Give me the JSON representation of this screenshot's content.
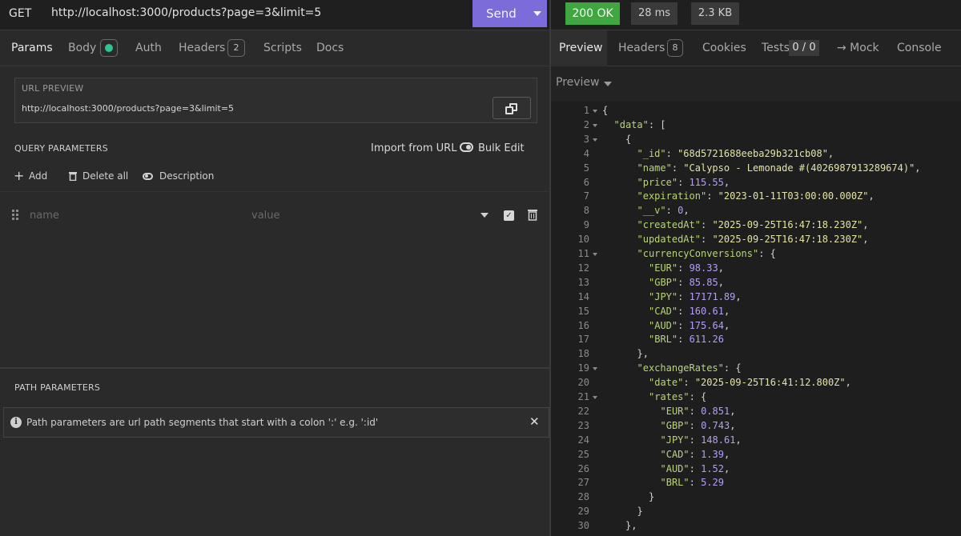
{
  "request": {
    "method": "GET",
    "url": "http://localhost:3000/products?page=3&limit=5",
    "send_label": "Send"
  },
  "left_tabs": {
    "params": "Params",
    "body": "Body",
    "auth": "Auth",
    "headers": "Headers",
    "headers_count": "2",
    "scripts": "Scripts",
    "docs": "Docs"
  },
  "url_preview": {
    "title": "URL PREVIEW",
    "url": "http://localhost:3000/products?page=3&limit=5"
  },
  "query_params": {
    "title": "QUERY PARAMETERS",
    "import_label": "Import from URL",
    "bulk_edit_label": "Bulk Edit",
    "add_label": "Add",
    "delete_all_label": "Delete all",
    "description_label": "Description",
    "name_placeholder": "name",
    "value_placeholder": "value"
  },
  "path_params": {
    "title": "PATH PARAMETERS",
    "info": "Path parameters are url path segments that start with a colon ':' e.g. ':id'"
  },
  "response_meta": {
    "status": "200 OK",
    "time": "28 ms",
    "size": "2.3 KB"
  },
  "right_tabs": {
    "preview": "Preview",
    "headers": "Headers",
    "headers_count": "8",
    "cookies": "Cookies",
    "tests": "Tests",
    "tests_count": "0 / 0",
    "mock": "→ Mock",
    "console": "Console"
  },
  "preview_mode": "Preview",
  "colors": {
    "accent": "#7b6cd9",
    "status_ok": "#3fa640",
    "json_key": "#b9d47a",
    "json_string": "#e3e4a6",
    "json_number": "#b69ef8"
  },
  "code_lines": [
    {
      "n": "1",
      "fold": true,
      "indent": 0,
      "parts": [
        [
          "p",
          "{"
        ]
      ]
    },
    {
      "n": "2",
      "fold": true,
      "indent": 1,
      "parts": [
        [
          "k",
          "\"data\""
        ],
        [
          "p",
          ": ["
        ]
      ]
    },
    {
      "n": "3",
      "fold": true,
      "indent": 2,
      "parts": [
        [
          "p",
          "{"
        ]
      ]
    },
    {
      "n": "4",
      "fold": false,
      "indent": 3,
      "parts": [
        [
          "k",
          "\"_id\""
        ],
        [
          "p",
          ": "
        ],
        [
          "s",
          "\"68d5721688eeba29b321cb08\""
        ],
        [
          "p",
          ","
        ]
      ]
    },
    {
      "n": "5",
      "fold": false,
      "indent": 3,
      "parts": [
        [
          "k",
          "\"name\""
        ],
        [
          "p",
          ": "
        ],
        [
          "s",
          "\"Calypso - Lemonade #(4026987913289674)\""
        ],
        [
          "p",
          ","
        ]
      ]
    },
    {
      "n": "6",
      "fold": false,
      "indent": 3,
      "parts": [
        [
          "k",
          "\"price\""
        ],
        [
          "p",
          ": "
        ],
        [
          "n",
          "115.55"
        ],
        [
          "p",
          ","
        ]
      ]
    },
    {
      "n": "7",
      "fold": false,
      "indent": 3,
      "parts": [
        [
          "k",
          "\"expiration\""
        ],
        [
          "p",
          ": "
        ],
        [
          "s",
          "\"2023-01-11T03:00:00.000Z\""
        ],
        [
          "p",
          ","
        ]
      ]
    },
    {
      "n": "8",
      "fold": false,
      "indent": 3,
      "parts": [
        [
          "k",
          "\"__v\""
        ],
        [
          "p",
          ": "
        ],
        [
          "n",
          "0"
        ],
        [
          "p",
          ","
        ]
      ]
    },
    {
      "n": "9",
      "fold": false,
      "indent": 3,
      "parts": [
        [
          "k",
          "\"createdAt\""
        ],
        [
          "p",
          ": "
        ],
        [
          "s",
          "\"2025-09-25T16:47:18.230Z\""
        ],
        [
          "p",
          ","
        ]
      ]
    },
    {
      "n": "10",
      "fold": false,
      "indent": 3,
      "parts": [
        [
          "k",
          "\"updatedAt\""
        ],
        [
          "p",
          ": "
        ],
        [
          "s",
          "\"2025-09-25T16:47:18.230Z\""
        ],
        [
          "p",
          ","
        ]
      ]
    },
    {
      "n": "11",
      "fold": true,
      "indent": 3,
      "parts": [
        [
          "k",
          "\"currencyConversions\""
        ],
        [
          "p",
          ": {"
        ]
      ]
    },
    {
      "n": "12",
      "fold": false,
      "indent": 4,
      "parts": [
        [
          "k",
          "\"EUR\""
        ],
        [
          "p",
          ": "
        ],
        [
          "n",
          "98.33"
        ],
        [
          "p",
          ","
        ]
      ]
    },
    {
      "n": "13",
      "fold": false,
      "indent": 4,
      "parts": [
        [
          "k",
          "\"GBP\""
        ],
        [
          "p",
          ": "
        ],
        [
          "n",
          "85.85"
        ],
        [
          "p",
          ","
        ]
      ]
    },
    {
      "n": "14",
      "fold": false,
      "indent": 4,
      "parts": [
        [
          "k",
          "\"JPY\""
        ],
        [
          "p",
          ": "
        ],
        [
          "n",
          "17171.89"
        ],
        [
          "p",
          ","
        ]
      ]
    },
    {
      "n": "15",
      "fold": false,
      "indent": 4,
      "parts": [
        [
          "k",
          "\"CAD\""
        ],
        [
          "p",
          ": "
        ],
        [
          "n",
          "160.61"
        ],
        [
          "p",
          ","
        ]
      ]
    },
    {
      "n": "16",
      "fold": false,
      "indent": 4,
      "parts": [
        [
          "k",
          "\"AUD\""
        ],
        [
          "p",
          ": "
        ],
        [
          "n",
          "175.64"
        ],
        [
          "p",
          ","
        ]
      ]
    },
    {
      "n": "17",
      "fold": false,
      "indent": 4,
      "parts": [
        [
          "k",
          "\"BRL\""
        ],
        [
          "p",
          ": "
        ],
        [
          "n",
          "611.26"
        ]
      ]
    },
    {
      "n": "18",
      "fold": false,
      "indent": 3,
      "parts": [
        [
          "p",
          "},"
        ]
      ]
    },
    {
      "n": "19",
      "fold": true,
      "indent": 3,
      "parts": [
        [
          "k",
          "\"exchangeRates\""
        ],
        [
          "p",
          ": {"
        ]
      ]
    },
    {
      "n": "20",
      "fold": false,
      "indent": 4,
      "parts": [
        [
          "k",
          "\"date\""
        ],
        [
          "p",
          ": "
        ],
        [
          "s",
          "\"2025-09-25T16:41:12.800Z\""
        ],
        [
          "p",
          ","
        ]
      ]
    },
    {
      "n": "21",
      "fold": true,
      "indent": 4,
      "parts": [
        [
          "k",
          "\"rates\""
        ],
        [
          "p",
          ": {"
        ]
      ]
    },
    {
      "n": "22",
      "fold": false,
      "indent": 5,
      "parts": [
        [
          "k",
          "\"EUR\""
        ],
        [
          "p",
          ": "
        ],
        [
          "n",
          "0.851"
        ],
        [
          "p",
          ","
        ]
      ]
    },
    {
      "n": "23",
      "fold": false,
      "indent": 5,
      "parts": [
        [
          "k",
          "\"GBP\""
        ],
        [
          "p",
          ": "
        ],
        [
          "n",
          "0.743"
        ],
        [
          "p",
          ","
        ]
      ]
    },
    {
      "n": "24",
      "fold": false,
      "indent": 5,
      "parts": [
        [
          "k",
          "\"JPY\""
        ],
        [
          "p",
          ": "
        ],
        [
          "n",
          "148.61"
        ],
        [
          "p",
          ","
        ]
      ]
    },
    {
      "n": "25",
      "fold": false,
      "indent": 5,
      "parts": [
        [
          "k",
          "\"CAD\""
        ],
        [
          "p",
          ": "
        ],
        [
          "n",
          "1.39"
        ],
        [
          "p",
          ","
        ]
      ]
    },
    {
      "n": "26",
      "fold": false,
      "indent": 5,
      "parts": [
        [
          "k",
          "\"AUD\""
        ],
        [
          "p",
          ": "
        ],
        [
          "n",
          "1.52"
        ],
        [
          "p",
          ","
        ]
      ]
    },
    {
      "n": "27",
      "fold": false,
      "indent": 5,
      "parts": [
        [
          "k",
          "\"BRL\""
        ],
        [
          "p",
          ": "
        ],
        [
          "n",
          "5.29"
        ]
      ]
    },
    {
      "n": "28",
      "fold": false,
      "indent": 4,
      "parts": [
        [
          "p",
          "}"
        ]
      ]
    },
    {
      "n": "29",
      "fold": false,
      "indent": 3,
      "parts": [
        [
          "p",
          "}"
        ]
      ]
    },
    {
      "n": "30",
      "fold": false,
      "indent": 2,
      "parts": [
        [
          "p",
          "},"
        ]
      ]
    }
  ]
}
